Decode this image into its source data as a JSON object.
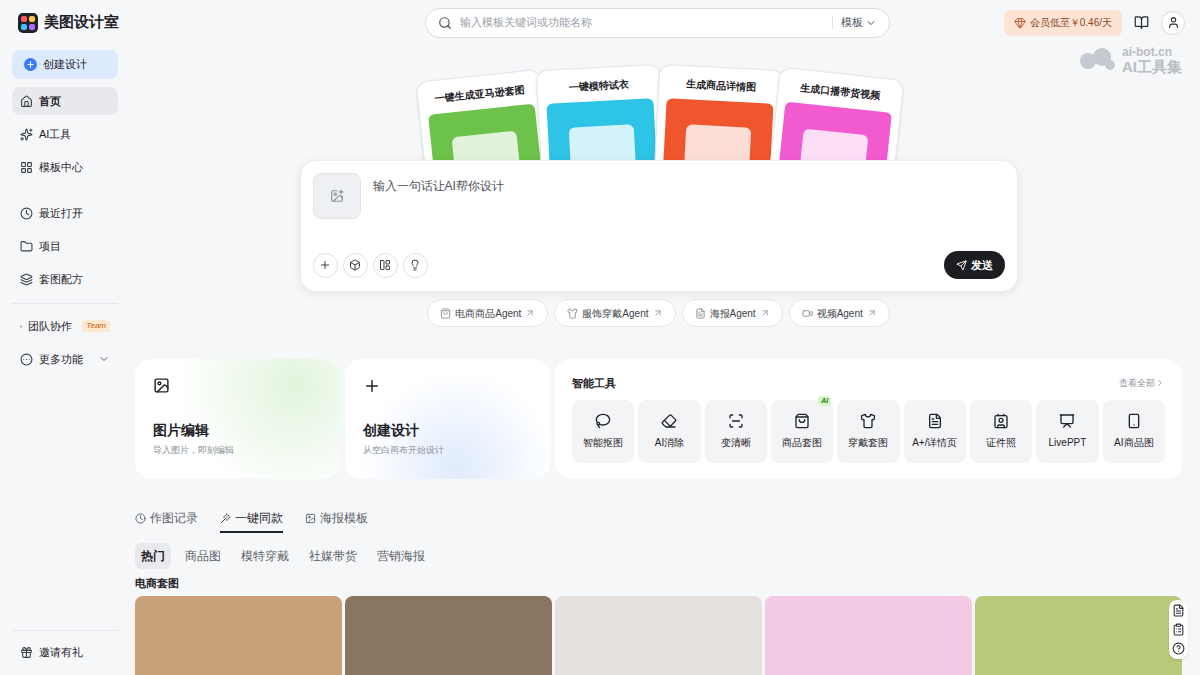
{
  "app": {
    "name": "美图设计室"
  },
  "search": {
    "placeholder": "输入模板关键词或功能名称",
    "scope": "模板"
  },
  "header": {
    "member_button": "会员低至￥0.46/天"
  },
  "watermark": {
    "line1": "ai-bot.cn",
    "line2": "AI工具集"
  },
  "sidebar": {
    "create_button": "创建设计",
    "groups": [
      [
        {
          "label": "首页",
          "selected": true
        },
        {
          "label": "AI工具",
          "selected": false
        },
        {
          "label": "模板中心",
          "selected": false
        }
      ],
      [
        {
          "label": "最近打开",
          "selected": false
        },
        {
          "label": "项目",
          "selected": false
        },
        {
          "label": "套图配方",
          "selected": false
        }
      ],
      [
        {
          "label": "团队协作",
          "selected": false,
          "badge": "Team"
        },
        {
          "label": "更多功能",
          "selected": false,
          "expanded": false
        }
      ]
    ],
    "footer": "邀请有礼"
  },
  "hero_cards": [
    {
      "title": "一键生成亚马逊套图",
      "color": "#6cc24a"
    },
    {
      "title": "一键模特试衣",
      "color": "#2ec4e6"
    },
    {
      "title": "生成商品详情图",
      "color": "#f0562e"
    },
    {
      "title": "生成口播带货视频",
      "color": "#f25bd0"
    }
  ],
  "prompt": {
    "placeholder": "输入一句话让AI帮你设计",
    "send": "发送"
  },
  "agents": [
    "电商商品Agent",
    "服饰穿戴Agent",
    "海报Agent",
    "视频Agent"
  ],
  "quick_cards": [
    {
      "title": "图片编辑",
      "subtitle": "导入图片，即刻编辑"
    },
    {
      "title": "创建设计",
      "subtitle": "从空白画布开始设计"
    }
  ],
  "tools": {
    "title": "智能工具",
    "more": "查看全部",
    "items": [
      {
        "label": "智能抠图"
      },
      {
        "label": "AI消除"
      },
      {
        "label": "变清晰"
      },
      {
        "label": "商品套图",
        "badge": "AI"
      },
      {
        "label": "穿戴套图"
      },
      {
        "label": "A+/详情页"
      },
      {
        "label": "证件照"
      },
      {
        "label": "LivePPT"
      },
      {
        "label": "AI商品图"
      }
    ]
  },
  "content_tabs": [
    {
      "label": "作图记录",
      "selected": false
    },
    {
      "label": "一键同款",
      "selected": true
    },
    {
      "label": "海报模板",
      "selected": false
    }
  ],
  "filters": [
    {
      "label": "热门",
      "selected": true
    },
    {
      "label": "商品图",
      "selected": false
    },
    {
      "label": "模特穿戴",
      "selected": false
    },
    {
      "label": "社媒带货",
      "selected": false
    },
    {
      "label": "营销海报",
      "selected": false
    }
  ],
  "section": {
    "title": "电商套图",
    "cards": [
      {
        "color": "#c9a27a"
      },
      {
        "color": "#8a7560"
      },
      {
        "color": "#e4e1dc"
      },
      {
        "color": "#f3c9e4"
      },
      {
        "color": "#b9c97a"
      }
    ]
  }
}
